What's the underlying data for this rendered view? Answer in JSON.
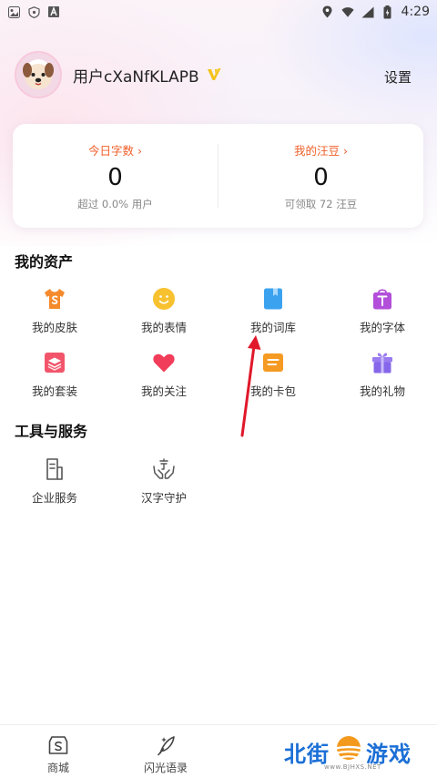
{
  "status_bar": {
    "time": "4:29",
    "left_icons": [
      "gallery-icon",
      "shield-icon",
      "a-icon"
    ],
    "right_icons": [
      "location-icon",
      "wifi-icon",
      "signal-icon",
      "battery-icon"
    ]
  },
  "profile": {
    "username": "用户cXaNfKLAPB",
    "settings_label": "设置"
  },
  "stats": {
    "left": {
      "label": "今日字数 ›",
      "value": "0",
      "sub": "超过 0.0% 用户"
    },
    "right": {
      "label": "我的汪豆 ›",
      "value": "0",
      "sub": "可领取 72 汪豆"
    }
  },
  "assets": {
    "title": "我的资产",
    "items": [
      {
        "label": "我的皮肤",
        "icon": "shirt-icon"
      },
      {
        "label": "我的表情",
        "icon": "smile-icon"
      },
      {
        "label": "我的词库",
        "icon": "book-icon"
      },
      {
        "label": "我的字体",
        "icon": "font-bag-icon"
      },
      {
        "label": "我的套装",
        "icon": "layers-icon"
      },
      {
        "label": "我的关注",
        "icon": "heart-icon"
      },
      {
        "label": "我的卡包",
        "icon": "card-icon"
      },
      {
        "label": "我的礼物",
        "icon": "gift-icon"
      }
    ]
  },
  "tools": {
    "title": "工具与服务",
    "items": [
      {
        "label": "企业服务",
        "icon": "document-icon"
      },
      {
        "label": "汉字守护",
        "icon": "hands-character-icon"
      }
    ]
  },
  "bottom_nav": {
    "items": [
      {
        "label": "商城",
        "icon": "shop-icon"
      },
      {
        "label": "闪光语录",
        "icon": "quill-icon"
      }
    ]
  },
  "watermark": {
    "text_left": "北街",
    "text_right": "游戏",
    "url": "www.BJHXS.NET"
  },
  "colors": {
    "accent": "#f0602a",
    "annotation_arrow": "#e0182a",
    "watermark_blue": "#1b6fd6",
    "watermark_orange": "#f39a1e"
  }
}
